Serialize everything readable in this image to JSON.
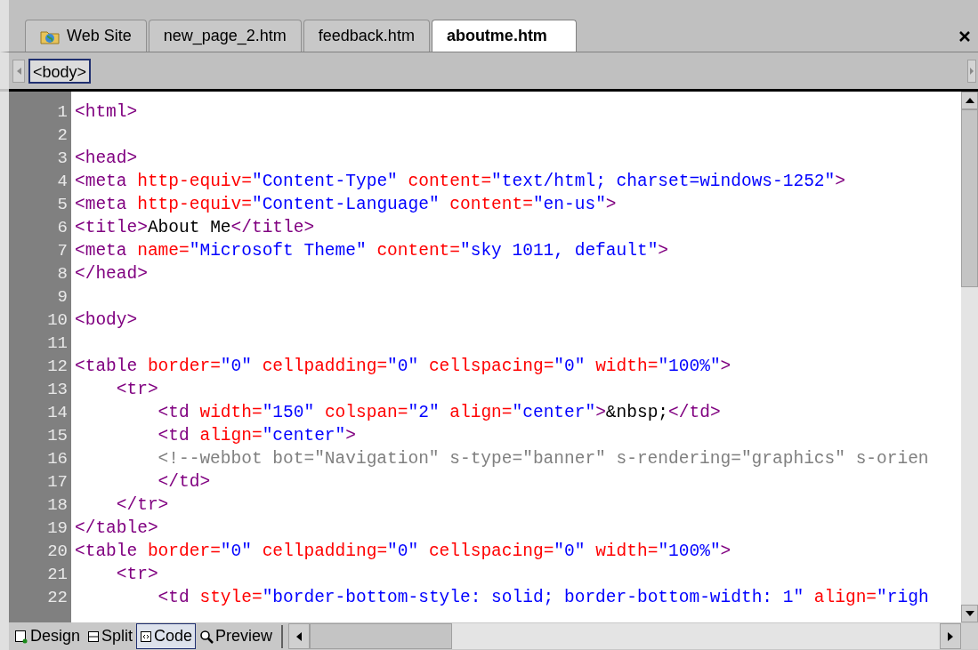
{
  "tabs": [
    {
      "label": "Web Site",
      "kind": "site",
      "selected": false
    },
    {
      "label": "new_page_2.htm",
      "kind": "file",
      "selected": false
    },
    {
      "label": "feedback.htm",
      "kind": "file",
      "selected": false
    },
    {
      "label": "aboutme.htm",
      "kind": "file",
      "selected": true
    }
  ],
  "breadcrumb": {
    "tag": "<body>"
  },
  "lines": [
    {
      "number": "1",
      "tokens": [
        {
          "kind": "tag",
          "text": "<html>"
        }
      ]
    },
    {
      "number": "2"
    },
    {
      "number": "3",
      "tokens": [
        {
          "kind": "tag",
          "text": "<head>"
        }
      ]
    },
    {
      "number": "4",
      "tokens": [
        {
          "kind": "tag",
          "text": "<meta "
        },
        {
          "kind": "attr",
          "text": "http-equiv="
        },
        {
          "kind": "value",
          "text": "\"Content-Type\" "
        },
        {
          "kind": "attr",
          "text": "content="
        },
        {
          "kind": "value",
          "text": "\"text/html; charset=windows-1252\""
        },
        {
          "kind": "tag",
          "text": ">"
        }
      ]
    },
    {
      "number": "5",
      "tokens": [
        {
          "kind": "tag",
          "text": "<meta "
        },
        {
          "kind": "attr",
          "text": "http-equiv="
        },
        {
          "kind": "value",
          "text": "\"Content-Language\" "
        },
        {
          "kind": "attr",
          "text": "content="
        },
        {
          "kind": "value",
          "text": "\"en-us\""
        },
        {
          "kind": "tag",
          "text": ">"
        }
      ]
    },
    {
      "number": "6",
      "tokens": [
        {
          "kind": "tag",
          "text": "<title>"
        },
        {
          "kind": "text",
          "text": "About Me"
        },
        {
          "kind": "tag",
          "text": "</title>"
        }
      ]
    },
    {
      "number": "7",
      "tokens": [
        {
          "kind": "tag",
          "text": "<meta "
        },
        {
          "kind": "attr",
          "text": "name="
        },
        {
          "kind": "value",
          "text": "\"Microsoft Theme\" "
        },
        {
          "kind": "attr",
          "text": "content="
        },
        {
          "kind": "value",
          "text": "\"sky 1011, default\""
        },
        {
          "kind": "tag",
          "text": ">"
        }
      ]
    },
    {
      "number": "8",
      "tokens": [
        {
          "kind": "tag",
          "text": "</head>"
        }
      ]
    },
    {
      "number": "9"
    },
    {
      "number": "10",
      "tokens": [
        {
          "kind": "tag",
          "text": "<body>"
        }
      ]
    },
    {
      "number": "11"
    },
    {
      "number": "12",
      "tokens": [
        {
          "kind": "tag",
          "text": "<table "
        },
        {
          "kind": "attr",
          "text": "border="
        },
        {
          "kind": "value",
          "text": "\"0\" "
        },
        {
          "kind": "attr",
          "text": "cellpadding="
        },
        {
          "kind": "value",
          "text": "\"0\" "
        },
        {
          "kind": "attr",
          "text": "cellspacing="
        },
        {
          "kind": "value",
          "text": "\"0\" "
        },
        {
          "kind": "attr",
          "text": "width="
        },
        {
          "kind": "value",
          "text": "\"100%\""
        },
        {
          "kind": "tag",
          "text": ">"
        }
      ]
    },
    {
      "number": "13",
      "tokens": [
        {
          "kind": "tag",
          "text": "    <tr>"
        }
      ]
    },
    {
      "number": "14",
      "tokens": [
        {
          "kind": "tag",
          "text": "        <td "
        },
        {
          "kind": "attr",
          "text": "width="
        },
        {
          "kind": "value",
          "text": "\"150\" "
        },
        {
          "kind": "attr",
          "text": "colspan="
        },
        {
          "kind": "value",
          "text": "\"2\" "
        },
        {
          "kind": "attr",
          "text": "align="
        },
        {
          "kind": "value",
          "text": "\"center\""
        },
        {
          "kind": "tag",
          "text": ">"
        },
        {
          "kind": "text",
          "text": "&nbsp;"
        },
        {
          "kind": "tag",
          "text": "</td>"
        }
      ]
    },
    {
      "number": "15",
      "tokens": [
        {
          "kind": "tag",
          "text": "        <td "
        },
        {
          "kind": "attr",
          "text": "align="
        },
        {
          "kind": "value",
          "text": "\"center\""
        },
        {
          "kind": "tag",
          "text": ">"
        }
      ]
    },
    {
      "number": "16",
      "tokens": [
        {
          "kind": "comment",
          "text": "        <!--webbot bot=\"Navigation\" s-type=\"banner\" s-rendering=\"graphics\" s-orien"
        }
      ]
    },
    {
      "number": "17",
      "tokens": [
        {
          "kind": "tag",
          "text": "        </td>"
        }
      ]
    },
    {
      "number": "18",
      "tokens": [
        {
          "kind": "tag",
          "text": "    </tr>"
        }
      ]
    },
    {
      "number": "19",
      "tokens": [
        {
          "kind": "tag",
          "text": "</table>"
        }
      ]
    },
    {
      "number": "20",
      "tokens": [
        {
          "kind": "tag",
          "text": "<table "
        },
        {
          "kind": "attr",
          "text": "border="
        },
        {
          "kind": "value",
          "text": "\"0\" "
        },
        {
          "kind": "attr",
          "text": "cellpadding="
        },
        {
          "kind": "value",
          "text": "\"0\" "
        },
        {
          "kind": "attr",
          "text": "cellspacing="
        },
        {
          "kind": "value",
          "text": "\"0\" "
        },
        {
          "kind": "attr",
          "text": "width="
        },
        {
          "kind": "value",
          "text": "\"100%\""
        },
        {
          "kind": "tag",
          "text": ">"
        }
      ]
    },
    {
      "number": "21",
      "tokens": [
        {
          "kind": "tag",
          "text": "    <tr>"
        }
      ]
    },
    {
      "number": "22",
      "tokens": [
        {
          "kind": "tag",
          "text": "        <td "
        },
        {
          "kind": "attr",
          "text": "style="
        },
        {
          "kind": "value",
          "text": "\"border-bottom-style: solid; border-bottom-width: 1\" "
        },
        {
          "kind": "attr",
          "text": "align="
        },
        {
          "kind": "value",
          "text": "\"righ"
        }
      ]
    }
  ],
  "view_tabs": [
    {
      "label": "Design",
      "kind": "design",
      "selected": false
    },
    {
      "label": "Split",
      "kind": "split",
      "selected": false
    },
    {
      "label": "Code",
      "kind": "code",
      "selected": true
    },
    {
      "label": "Preview",
      "kind": "preview",
      "selected": false
    }
  ]
}
